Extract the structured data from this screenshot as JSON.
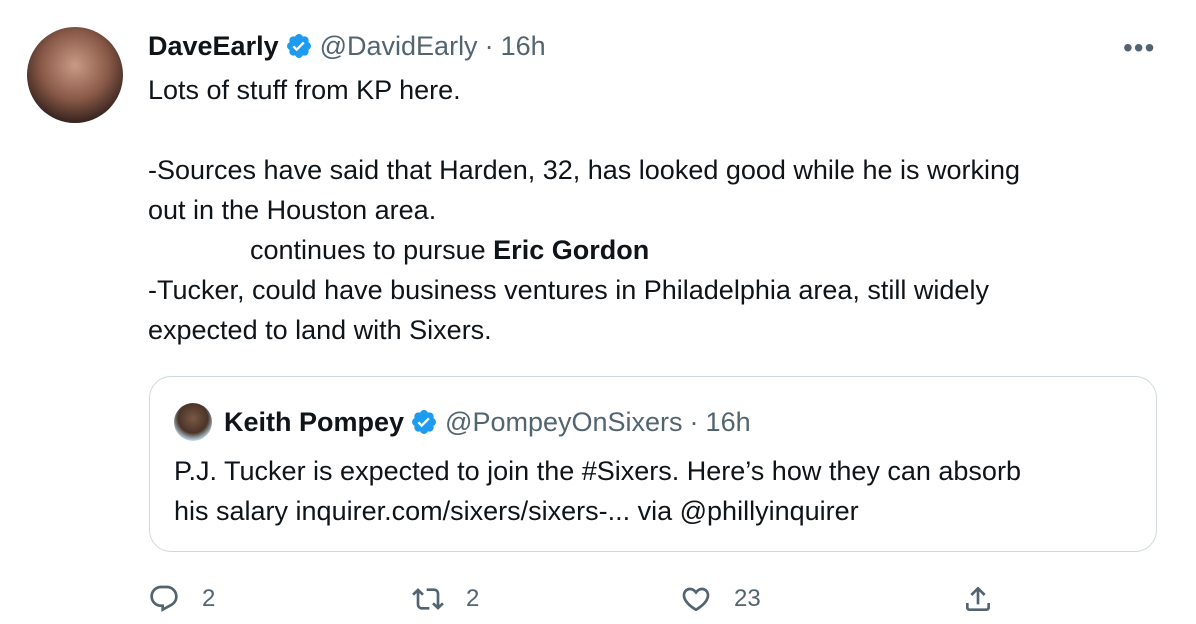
{
  "tweet": {
    "author": {
      "name": "DaveEarly",
      "handle": "@DavidEarly",
      "separator": "·",
      "time": "16h",
      "verified": true
    },
    "more_label": "•••",
    "lines": [
      "Lots of stuff from KP here.",
      "",
      "-Sources have said that Harden, 32, has looked good while he is working",
      "out in the Houston area.",
      "continues to pursue ",
      "Eric Gordon",
      "-Tucker, could have business ventures in Philadelphia area, still widely",
      "expected to land with Sixers."
    ],
    "quote": {
      "name": "Keith Pompey",
      "handle": "@PompeyOnSixers",
      "separator": "·",
      "time": "16h",
      "verified": true,
      "line1": "P.J. Tucker is expected to join the #Sixers. Here’s how they can absorb",
      "line2": "his salary inquirer.com/sixers/sixers-... via @phillyinquirer"
    },
    "actions": {
      "reply_count": "2",
      "retweet_count": "2",
      "like_count": "23"
    },
    "colors": {
      "verified": "#1d9bf0",
      "secondary_text": "#536471",
      "border": "#cfd9de"
    }
  }
}
